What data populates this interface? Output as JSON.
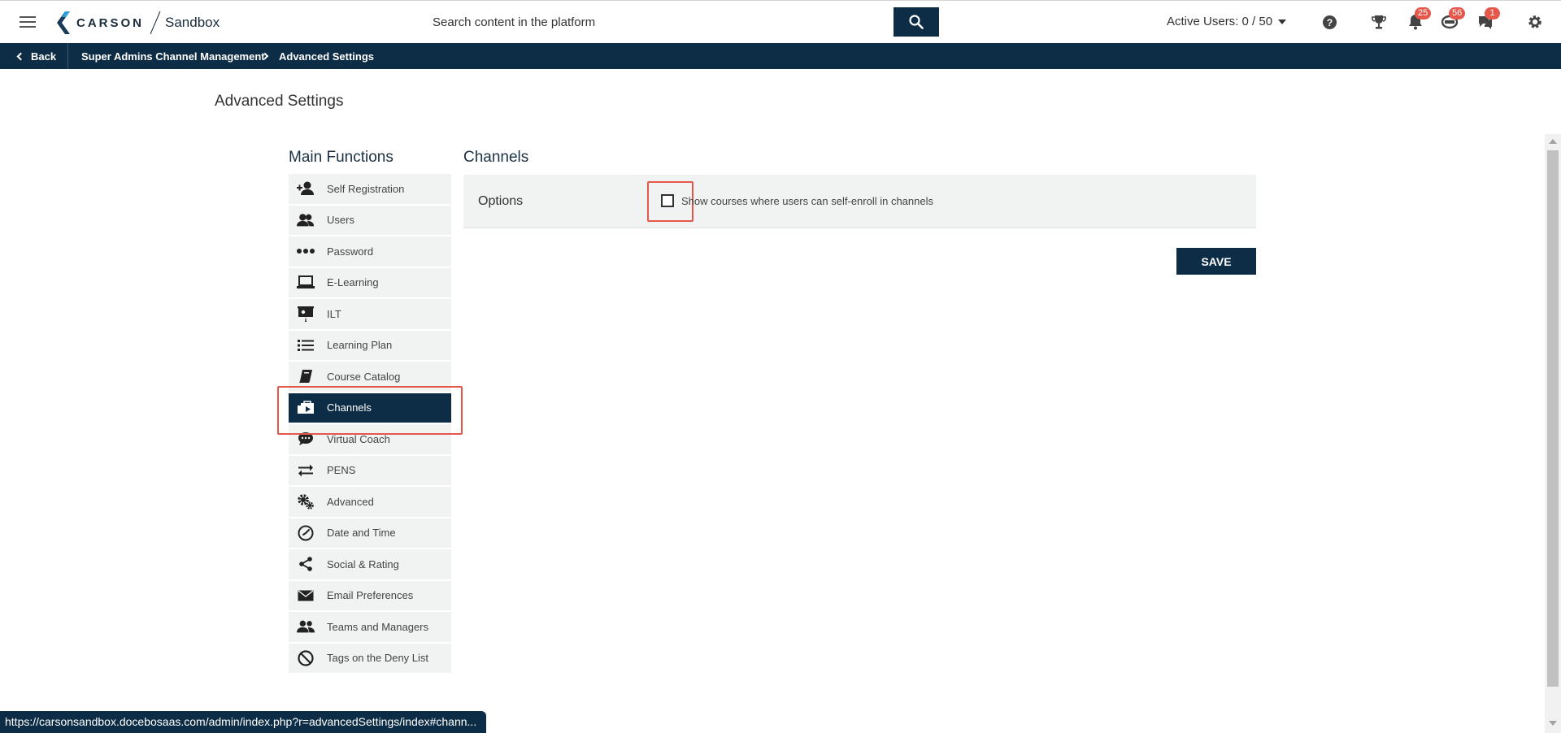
{
  "header": {
    "brand_name": "CARSON",
    "brand_product": "Sandbox",
    "search_placeholder": "Search content in the platform",
    "active_users": "Active Users: 0 / 50",
    "badges": {
      "notifications": "25",
      "messages": "56",
      "chat": "1"
    },
    "brand_colors": {
      "navy": "#0d2d46",
      "badge_red": "#e4574a"
    }
  },
  "breadcrumb": {
    "back_label": "Back",
    "items": [
      "Super Admins Channel Management",
      "Advanced Settings"
    ]
  },
  "page": {
    "title": "Advanced Settings"
  },
  "sidebar": {
    "title": "Main Functions",
    "active_item": "Channels",
    "items": [
      {
        "label": "Self Registration",
        "icon": "add-user-icon"
      },
      {
        "label": "Users",
        "icon": "users-icon"
      },
      {
        "label": "Password",
        "icon": "dots-icon"
      },
      {
        "label": "E-Learning",
        "icon": "laptop-icon"
      },
      {
        "label": "ILT",
        "icon": "presentation-icon"
      },
      {
        "label": "Learning Plan",
        "icon": "list-icon"
      },
      {
        "label": "Course Catalog",
        "icon": "book-icon"
      },
      {
        "label": "Channels",
        "icon": "channels-icon"
      },
      {
        "label": "Virtual Coach",
        "icon": "chat-bubble-icon"
      },
      {
        "label": "PENS",
        "icon": "arrows-exchange-icon"
      },
      {
        "label": "Advanced",
        "icon": "gears-icon"
      },
      {
        "label": "Date and Time",
        "icon": "clock-icon"
      },
      {
        "label": "Social & Rating",
        "icon": "share-icon"
      },
      {
        "label": "Email Preferences",
        "icon": "envelope-icon"
      },
      {
        "label": "Teams and Managers",
        "icon": "team-icon"
      },
      {
        "label": "Tags on the Deny List",
        "icon": "ban-icon"
      }
    ]
  },
  "content": {
    "section_title": "Channels",
    "options_label": "Options",
    "checkbox_label": "Show courses where users can self-enroll in channels",
    "checkbox_checked": false,
    "save_label": "SAVE"
  },
  "status_bar": {
    "url": "https://carsonsandbox.docebosaas.com/admin/index.php?r=advancedSettings/index#chann..."
  }
}
